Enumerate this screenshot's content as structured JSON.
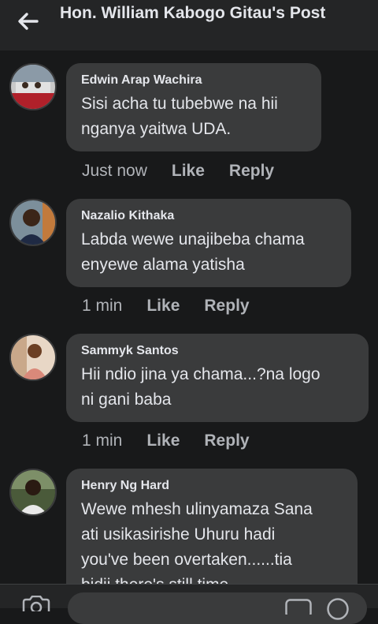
{
  "header": {
    "title": "Hon. William Kabogo Gitau's Post",
    "back_icon": "arrow-left-icon"
  },
  "comments": [
    {
      "author": "Edwin Arap Wachira",
      "text": "Sisi acha tu tubebwe na hii\nnganya yaitwa UDA.",
      "time": "Just now",
      "like": "Like",
      "reply": "Reply"
    },
    {
      "author": "Nazalio Kithaka",
      "text": "Labda wewe unajibeba chama\nenyewe alama yatisha",
      "time": "1 min",
      "like": "Like",
      "reply": "Reply"
    },
    {
      "author": "Sammyk Santos",
      "text": "Hii ndio jina ya chama...?na logo\nni gani baba",
      "time": "1 min",
      "like": "Like",
      "reply": "Reply"
    },
    {
      "author": "Henry Ng Hard",
      "text": "Wewe mhesh ulinyamaza Sana\nati usikasirishe Uhuru hadi\nyou've been overtaken......tia\nbidii there's still time",
      "time": "",
      "like": "",
      "reply": ""
    }
  ],
  "composer": {
    "camera_icon": "camera-icon",
    "gif_icon": "gif-icon",
    "emoji_icon": "emoji-icon"
  },
  "colors": {
    "background": "#18191a",
    "header": "#242526",
    "bubble": "#3a3b3c",
    "text": "#e4e6eb",
    "secondary_text": "#b0b3b8"
  }
}
